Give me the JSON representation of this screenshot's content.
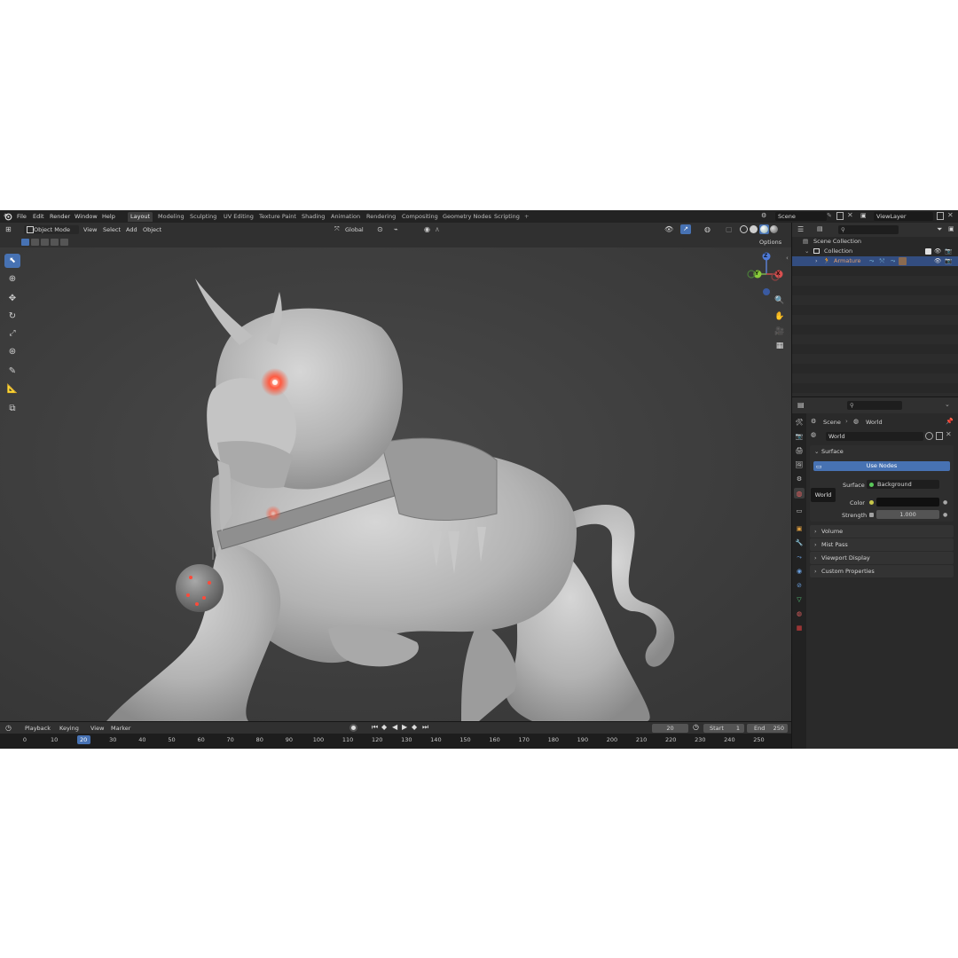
{
  "menu": [
    "File",
    "Edit",
    "Render",
    "Window",
    "Help"
  ],
  "workspaces": [
    "Layout",
    "Modeling",
    "Sculpting",
    "UV Editing",
    "Texture Paint",
    "Shading",
    "Animation",
    "Rendering",
    "Compositing",
    "Geometry Nodes",
    "Scripting"
  ],
  "workspace_add": "+",
  "scene": {
    "name": "Scene",
    "viewlayer": "ViewLayer"
  },
  "viewport": {
    "mode": "Object Mode",
    "menus": [
      "View",
      "Select",
      "Add",
      "Object"
    ],
    "transform_orientation": "Global",
    "options_label": "Options",
    "gizmo": {
      "z": "Z",
      "y": "Y",
      "x": "X"
    }
  },
  "outliner": {
    "scene_collection": "Scene Collection",
    "collection": "Collection",
    "armature": "Armature"
  },
  "properties": {
    "breadcrumb": [
      "Scene",
      "World"
    ],
    "world_name": "World",
    "surface_panel": "Surface",
    "use_nodes": "Use Nodes",
    "surface_label": "Surface",
    "surface_value": "Background",
    "color_label": "Color",
    "strength_label": "Strength",
    "strength_value": "1.000",
    "panels": [
      "Volume",
      "Mist Pass",
      "Viewport Display",
      "Custom Properties"
    ],
    "tooltip": "World"
  },
  "timeline": {
    "menus": [
      "Playback",
      "Keying",
      "View",
      "Marker"
    ],
    "current_frame": "20",
    "start_label": "Start",
    "start_value": "1",
    "end_label": "End",
    "end_value": "250",
    "ticks": [
      "0",
      "10",
      "20",
      "30",
      "40",
      "50",
      "60",
      "70",
      "80",
      "90",
      "100",
      "110",
      "120",
      "130",
      "140",
      "150",
      "160",
      "170",
      "180",
      "190",
      "200",
      "210",
      "220",
      "230",
      "240",
      "250"
    ]
  },
  "colors": {
    "accent": "#4772b3",
    "armature": "#e0a070",
    "eye_glow": "#ff4a3a"
  }
}
